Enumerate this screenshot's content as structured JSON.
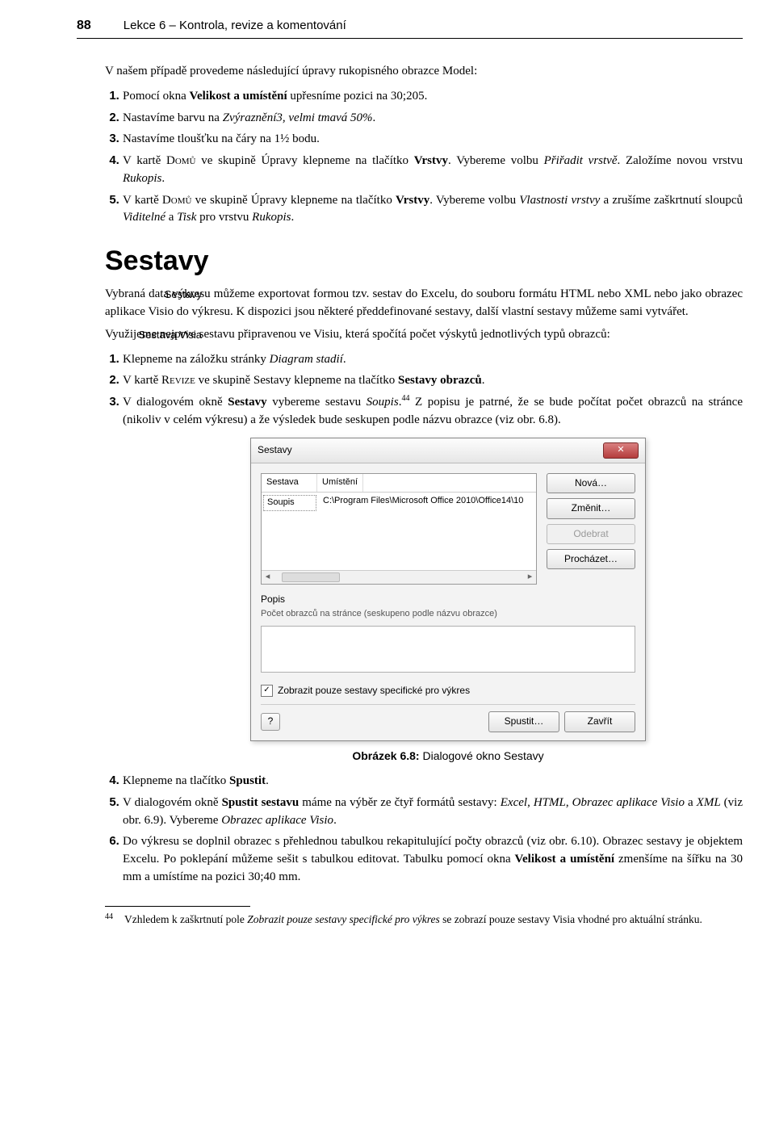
{
  "pageNumber": "88",
  "lessonHeader": "Lekce 6 – Kontrola, revize a komentování",
  "intro": "V našem případě provedeme následující úpravy rukopisného obrazce Model:",
  "stepsA": {
    "s1a": "Pomocí okna ",
    "s1b": "Velikost a umístění",
    "s1c": " upřesníme pozici na 30;205.",
    "s2a": "Nastavíme barvu na ",
    "s2b": "Zvýraznění3, velmi tmavá 50%",
    "s2c": ".",
    "s3": "Nastavíme tloušťku na čáry na 1½ bodu.",
    "s4a": "V kartě ",
    "s4b": "Domů",
    "s4c": " ve skupině Úpravy klepneme na tlačítko ",
    "s4d": "Vrstvy",
    "s4e": ". Vybereme volbu ",
    "s4f": "Přiřadit vrstvě",
    "s4g": ". Založíme novou vrstvu ",
    "s4h": "Rukopis",
    "s4i": ".",
    "s5a": "V kartě ",
    "s5b": "Domů",
    "s5c": " ve skupině Úpravy klepneme na tlačítko ",
    "s5d": "Vrstvy",
    "s5e": ". Vybereme volbu ",
    "s5f": "Vlastnosti vrstvy",
    "s5g": " a zrušíme zaškrtnutí sloupců ",
    "s5h": "Viditelné",
    "s5i": " a ",
    "s5j": "Tisk",
    "s5k": " pro vrstvu ",
    "s5l": "Rukopis",
    "s5m": "."
  },
  "heading": "Sestavy",
  "sidenote1": "Sestavy",
  "sidenote2": "Sestava Visia",
  "paraSestavy": "Vybraná data výkresu můžeme exportovat formou tzv. sestav do Excelu, do souboru formátu HTML nebo XML nebo jako obrazec aplikace Visio do výkresu. K dispozici jsou některé předdefinované sestavy, další vlastní sestavy můžeme sami vytvářet.",
  "paraVisia": "Využijeme nejprve sestavu připravenou ve Visiu, která spočítá počet výskytů jednotlivých typů obrazců:",
  "stepsB": {
    "s1a": "Klepneme na záložku stránky ",
    "s1b": "Diagram stadií",
    "s1c": ".",
    "s2a": "V kartě ",
    "s2b": "Revize",
    "s2c": " ve skupině Sestavy klepneme na tlačítko ",
    "s2d": "Sestavy obrazců",
    "s2e": ".",
    "s3a": "V dialogovém okně ",
    "s3b": "Sestavy",
    "s3c": " vybereme sestavu ",
    "s3d": "Soupis",
    "s3e": ".",
    "s3f": "44",
    "s3g": " Z popisu je patrné, že se bude počítat počet obrazců na stránce (nikoliv v celém výkresu) a že výsledek bude seskupen podle názvu obrazce (viz obr. 6.8)."
  },
  "dialog": {
    "title": "Sestavy",
    "col1": "Sestava",
    "col2": "Umístění",
    "row1c1": "Soupis",
    "row1c2": "C:\\Program Files\\Microsoft Office 2010\\Office14\\10",
    "btnNew": "Nová…",
    "btnEdit": "Změnit…",
    "btnRemove": "Odebrat",
    "btnBrowse": "Procházet…",
    "popisLabel": "Popis",
    "popisText": "Počet obrazců na stránce (seskupeno podle názvu obrazce)",
    "checkbox": "Zobrazit pouze sestavy specifické pro výkres",
    "help": "?",
    "btnRun": "Spustit…",
    "btnClose": "Zavřít"
  },
  "figureCaption": {
    "bold": "Obrázek 6.8:",
    "rest": " Dialogové okno Sestavy"
  },
  "stepsC": {
    "s4a": "Klepneme na tlačítko ",
    "s4b": "Spustit",
    "s4c": ".",
    "s5a": "V dialogovém okně ",
    "s5b": "Spustit sestavu",
    "s5c": " máme na výběr ze čtyř formátů sestavy: ",
    "s5d": "Excel",
    "s5e": ", ",
    "s5f": "HTML",
    "s5g": ", ",
    "s5h": "Obrazec aplikace Visio",
    "s5i": " a ",
    "s5j": "XML",
    "s5k": " (viz obr. 6.9). Vybereme ",
    "s5l": "Obrazec aplikace Visio",
    "s5m": ".",
    "s6a": "Do výkresu se doplnil obrazec s přehlednou tabulkou rekapitulující počty obrazců (viz obr. 6.10). Obrazec sestavy je objektem Excelu. Po poklepání můžeme sešit s tabulkou editovat. Tabulku pomocí okna ",
    "s6b": "Velikost a umístění",
    "s6c": " zmenšíme na šířku na 30 mm a umístíme na pozici 30;40 mm."
  },
  "footnote": {
    "num": "44",
    "a": "Vzhledem k zaškrtnutí pole ",
    "b": "Zobrazit pouze sestavy specifické pro výkres",
    "c": " se zobrazí pouze sestavy Visia vhodné pro aktuální stránku."
  }
}
